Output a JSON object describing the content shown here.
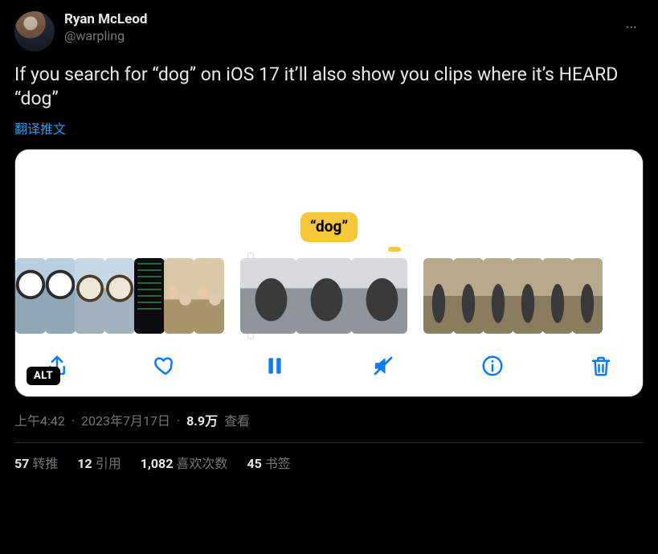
{
  "author": {
    "display_name": "Ryan McLeod",
    "handle": "@warpling"
  },
  "tweet_text": "If you search for “dog” on iOS 17 it’ll also show you clips where it’s HEARD “dog”",
  "translate_label": "翻译推文",
  "media": {
    "search_token": "“dog”",
    "alt_badge": "ALT",
    "toolbar_icons": {
      "share": "share-icon",
      "like": "heart-icon",
      "pause": "pause-icon",
      "mute": "mute-icon",
      "info": "info-icon",
      "delete": "trash-icon"
    }
  },
  "meta": {
    "time": "上午4:42",
    "date": "2023年7月17日",
    "views_number": "8.9万",
    "views_label": "查看",
    "separator": "·"
  },
  "stats": {
    "retweets": {
      "count": "57",
      "label": "转推"
    },
    "quotes": {
      "count": "12",
      "label": "引用"
    },
    "likes": {
      "count": "1,082",
      "label": "喜欢次数"
    },
    "bookmarks": {
      "count": "45",
      "label": "书签"
    }
  }
}
